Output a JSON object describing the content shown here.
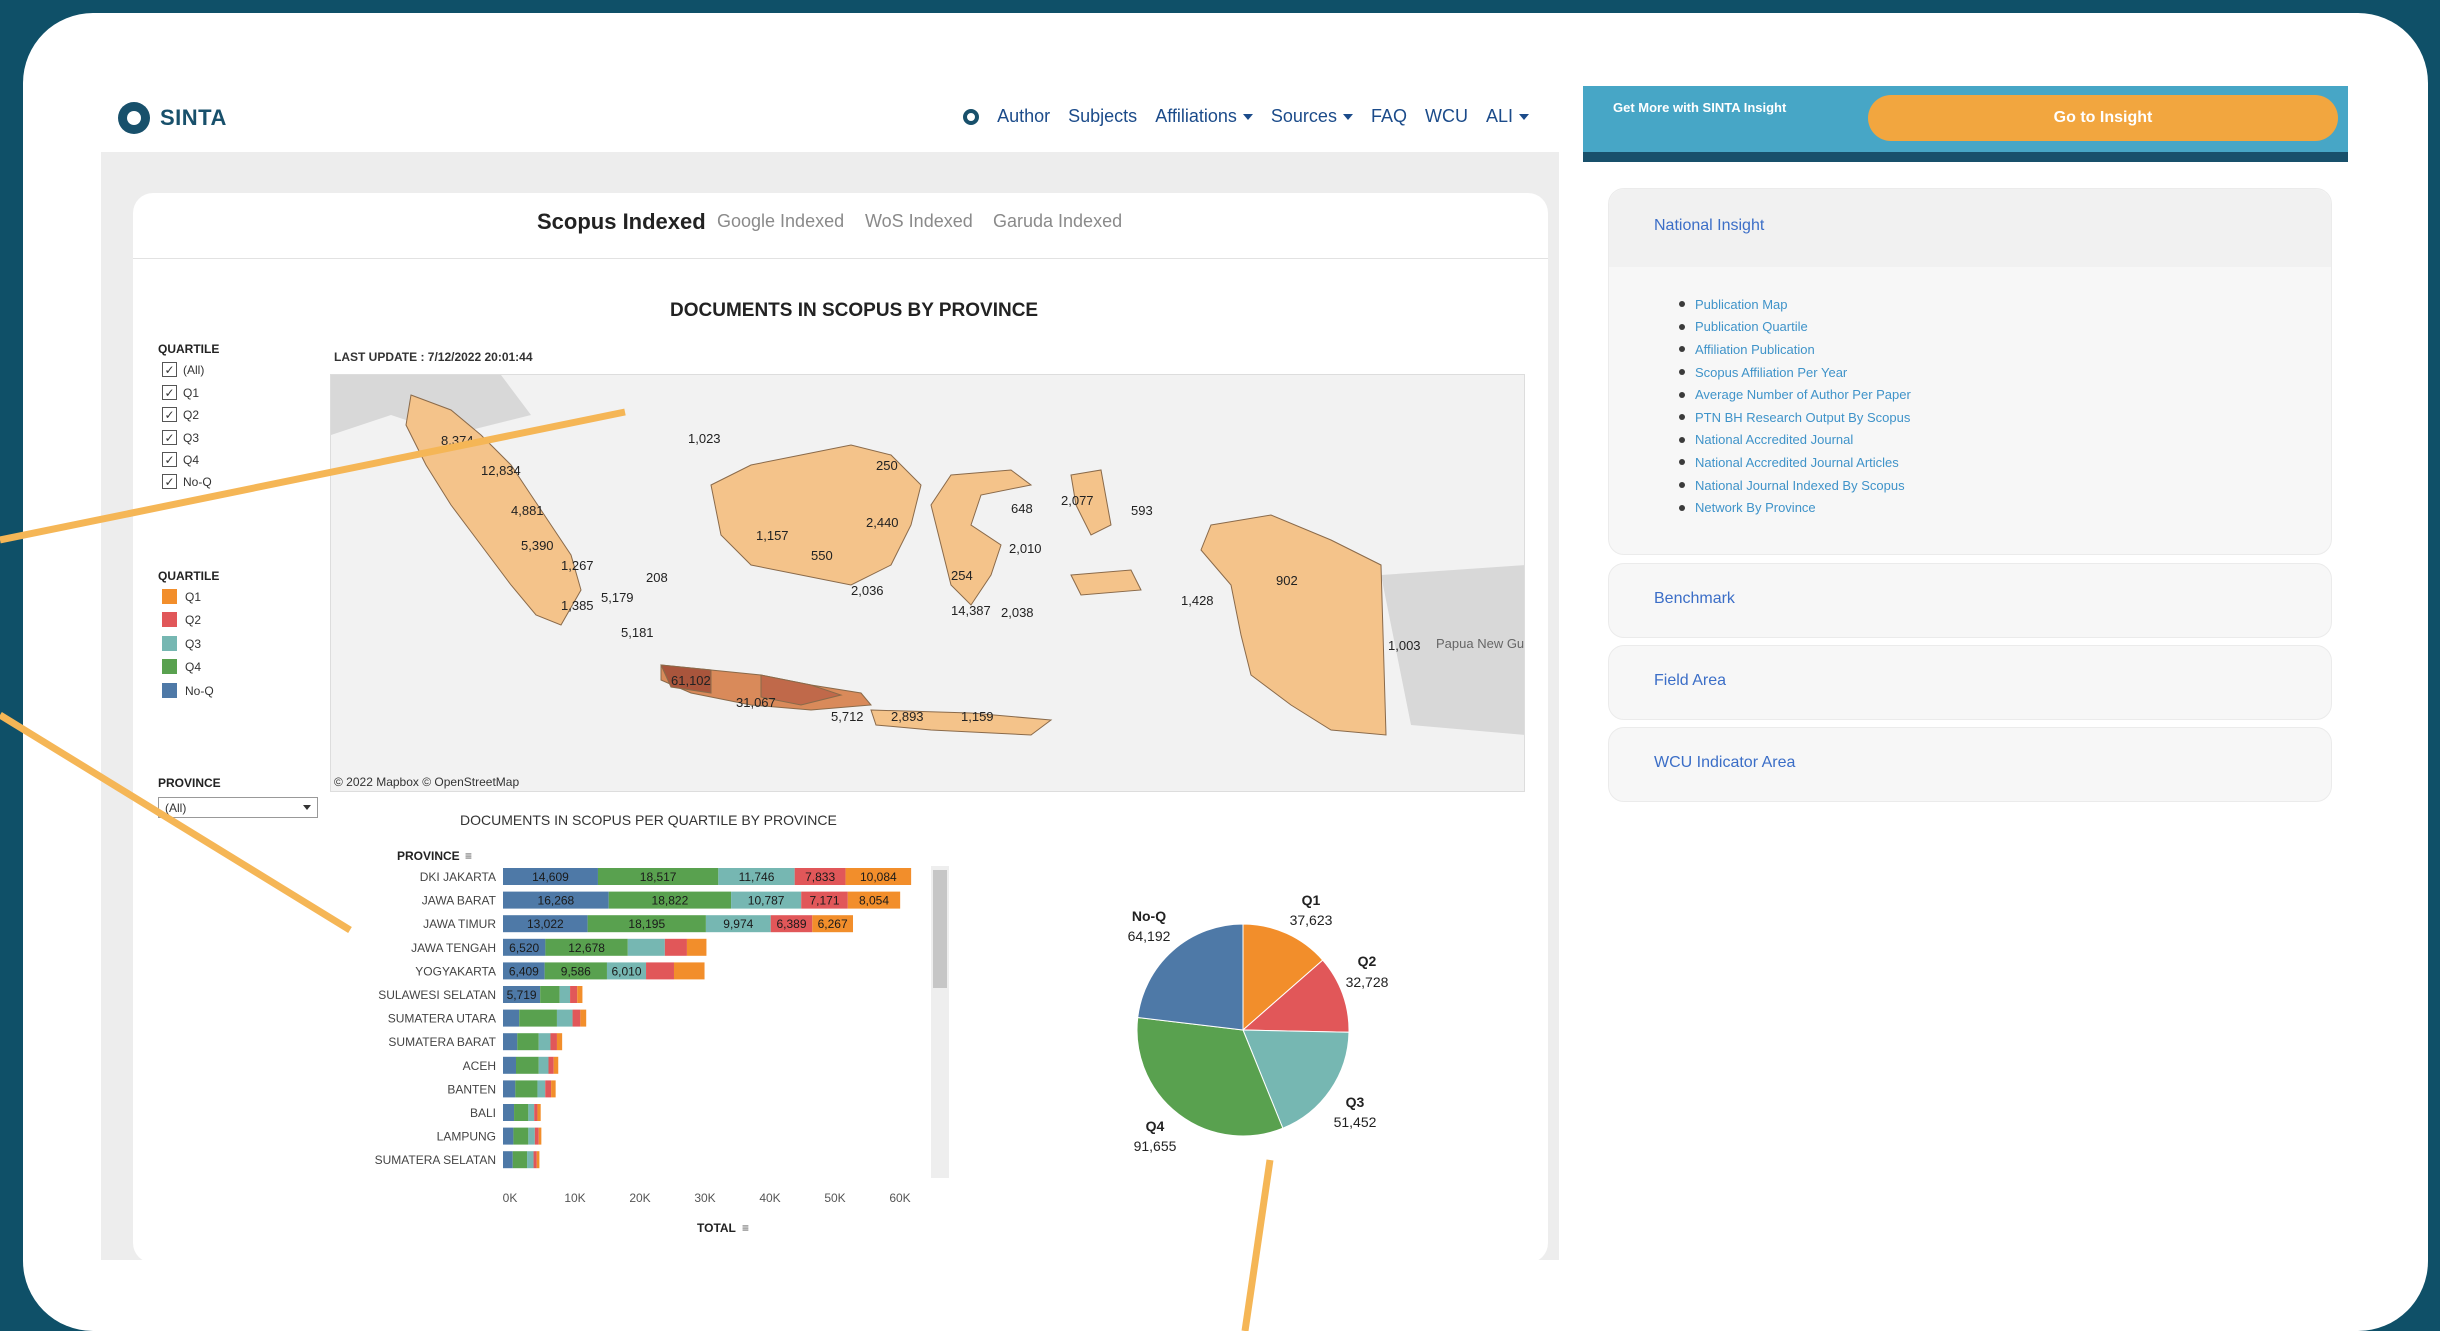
{
  "nav": {
    "brand": "SINTA",
    "items": [
      {
        "label": "Author",
        "dropdown": false
      },
      {
        "label": "Subjects",
        "dropdown": false
      },
      {
        "label": "Affiliations",
        "dropdown": true
      },
      {
        "label": "Sources",
        "dropdown": true
      },
      {
        "label": "FAQ",
        "dropdown": false
      },
      {
        "label": "WCU",
        "dropdown": false
      },
      {
        "label": "ALI",
        "dropdown": true
      }
    ]
  },
  "tabs": [
    "Scopus Indexed",
    "Google Indexed",
    "WoS Indexed",
    "Garuda Indexed"
  ],
  "map_section": {
    "title": "DOCUMENTS IN SCOPUS BY PROVINCE",
    "last_update": "LAST UPDATE : 7/12/2022 20:01:44",
    "attribution": "© 2022 Mapbox © OpenStreetMap",
    "neighbor_label": "Papua New Guinea",
    "region_values": [
      "8,374",
      "12,834",
      "4,881",
      "5,390",
      "1,267",
      "1,385",
      "5,179",
      "5,181",
      "208",
      "1,023",
      "250",
      "2,440",
      "1,157",
      "550",
      "2,036",
      "648",
      "2,077",
      "593",
      "2,010",
      "254",
      "14,387",
      "2,038",
      "1,428",
      "902",
      "1,003",
      "61,102",
      "31,067",
      "5,712",
      "2,893",
      "1,159"
    ]
  },
  "filters": {
    "quartile_title": "QUARTILE",
    "quartile_checks": [
      "(All)",
      "Q1",
      "Q2",
      "Q3",
      "Q4",
      "No-Q"
    ],
    "legend_title": "QUARTILE",
    "legend": [
      {
        "label": "Q1",
        "color": "#f28e2b"
      },
      {
        "label": "Q2",
        "color": "#e15759"
      },
      {
        "label": "Q3",
        "color": "#76b7b2"
      },
      {
        "label": "Q4",
        "color": "#59a14f"
      },
      {
        "label": "No-Q",
        "color": "#4e79a7"
      }
    ],
    "province_title": "PROVINCE",
    "province_value": "(All)"
  },
  "chart_data": [
    {
      "type": "bar",
      "orientation": "horizontal-stacked",
      "title": "DOCUMENTS IN SCOPUS PER QUARTILE BY PROVINCE",
      "ylabel": "PROVINCE",
      "xlabel": "TOTAL",
      "xlim": [
        0,
        65000
      ],
      "xticks": [
        "0K",
        "10K",
        "20K",
        "30K",
        "40K",
        "50K",
        "60K"
      ],
      "categories": [
        "DKI JAKARTA",
        "JAWA BARAT",
        "JAWA TIMUR",
        "JAWA TENGAH",
        "YOGYAKARTA",
        "SULAWESI SELATAN",
        "SUMATERA UTARA",
        "SUMATERA BARAT",
        "ACEH",
        "BANTEN",
        "BALI",
        "LAMPUNG",
        "SUMATERA SELATAN"
      ],
      "series": [
        {
          "name": "No-Q",
          "color": "#4e79a7",
          "values": [
            14609,
            16268,
            13022,
            6520,
            6409,
            5719,
            2500,
            2200,
            2000,
            1900,
            1700,
            1600,
            1500
          ]
        },
        {
          "name": "Q4",
          "color": "#59a14f",
          "values": [
            18517,
            18822,
            18195,
            12678,
            9586,
            3000,
            5800,
            3300,
            3500,
            3400,
            2200,
            2300,
            2200
          ]
        },
        {
          "name": "Q3",
          "color": "#76b7b2",
          "values": [
            11746,
            10787,
            9974,
            5700,
            6010,
            1600,
            2400,
            1800,
            1500,
            1200,
            900,
            1000,
            1000
          ]
        },
        {
          "name": "Q2",
          "color": "#e15759",
          "values": [
            7833,
            7171,
            6389,
            3400,
            4300,
            1100,
            1200,
            1000,
            800,
            900,
            500,
            600,
            500
          ]
        },
        {
          "name": "Q1",
          "color": "#f28e2b",
          "values": [
            10084,
            8054,
            6267,
            3000,
            4700,
            800,
            900,
            800,
            700,
            700,
            500,
            400,
            400
          ]
        }
      ],
      "data_labels": [
        [
          "14,609",
          "18,517",
          "11,746",
          "7,833",
          "10,084"
        ],
        [
          "16,268",
          "18,822",
          "10,787",
          "7,171",
          "8,054"
        ],
        [
          "13,022",
          "18,195",
          "9,974",
          "6,389",
          "6,267"
        ],
        [
          "6,520",
          "12,678",
          "",
          "",
          ""
        ],
        [
          "6,409",
          "9,586",
          "6,010",
          "",
          ""
        ],
        [
          "5,719",
          "",
          "",
          "",
          ""
        ]
      ]
    },
    {
      "type": "pie",
      "categories": [
        "Q1",
        "Q2",
        "Q3",
        "Q4",
        "No-Q"
      ],
      "values": [
        37623,
        32728,
        51452,
        91655,
        64192
      ],
      "value_labels": [
        "37,623",
        "32,728",
        "51,452",
        "91,655",
        "64,192"
      ],
      "colors": [
        "#f28e2b",
        "#e15759",
        "#76b7b2",
        "#59a14f",
        "#4e79a7"
      ]
    }
  ],
  "right_panel": {
    "insight_text": "Get More with SINTA Insight",
    "insight_button": "Go to Insight",
    "national_title": "National Insight",
    "national_links": [
      "Publication Map",
      "Publication Quartile",
      "Affiliation Publication",
      "Scopus Affiliation Per Year",
      "Average Number of Author Per Paper",
      "PTN BH Research Output By Scopus",
      "National Accredited Journal",
      "National Accredited Journal Articles",
      "National Journal Indexed By Scopus",
      "Network By Province"
    ],
    "sections": [
      "Benchmark",
      "Field Area",
      "WCU Indicator Area"
    ]
  },
  "colors": {
    "background": "#0f5068",
    "annotation_line": "#f5b656",
    "map_fill": "#f4c38a"
  }
}
